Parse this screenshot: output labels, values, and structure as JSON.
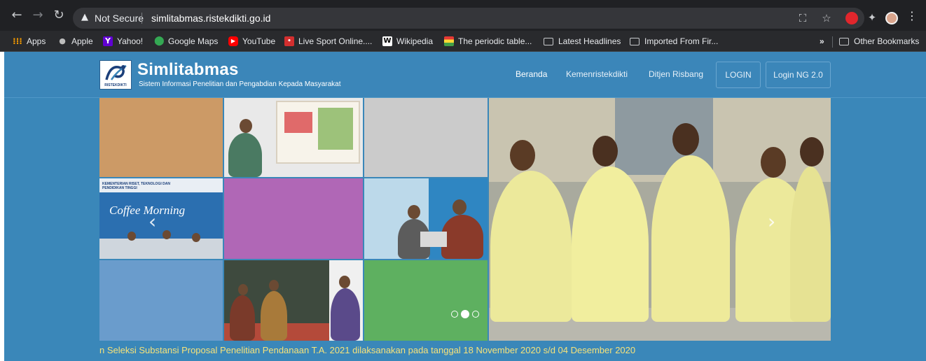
{
  "browser": {
    "security_label": "Not Secure",
    "url": "simlitabmas.ristekdikti.go.id",
    "bookmarks": [
      {
        "label": "Apps",
        "icon": "apps-grid-icon"
      },
      {
        "label": "Apple",
        "icon": "apple-icon"
      },
      {
        "label": "Yahoo!",
        "icon": "yahoo-icon"
      },
      {
        "label": "Google Maps",
        "icon": "maps-pin-icon"
      },
      {
        "label": "YouTube",
        "icon": "youtube-icon"
      },
      {
        "label": "Live Sport Online....",
        "icon": "sport-icon"
      },
      {
        "label": "Wikipedia",
        "icon": "wikipedia-icon"
      },
      {
        "label": "The periodic table...",
        "icon": "periodic-icon"
      },
      {
        "label": "Latest Headlines",
        "icon": "folder-icon"
      },
      {
        "label": "Imported From Fir...",
        "icon": "folder-icon"
      }
    ],
    "overflow_label": "»",
    "other_bookmarks": "Other Bookmarks"
  },
  "site": {
    "title": "Simlitabmas",
    "subtitle": "Sistem Informasi Penelitian dan Pengabdian Kepada Masyarakat",
    "logo_caption": "RISTEKDIKTI",
    "nav": {
      "home": "Beranda",
      "ministry": "Kemenristekdikti",
      "directorate": "Ditjen Risbang",
      "login": "LOGIN",
      "login_ng": "Login NG 2.0"
    },
    "banner_text": "KEMENTERIAN RISET, TEKNOLOGI DAN PENDIDIKAN TINGGI",
    "coffee_text": "Coffee Morning",
    "slider_pages": 3,
    "slider_active": 2,
    "ticker": "n Seleksi Substansi Proposal Penelitian Pendanaan T.A. 2021 dilaksanakan pada tanggal 18 November 2020 s/d 04 Desember 2020"
  },
  "colors": {
    "page_bg": "#3a87b9",
    "tile_tan": "#cc9a66",
    "tile_purple": "#b067b6",
    "tile_blue": "#6a9ccc",
    "tile_green": "#5eb060",
    "tile_gray": "#cbcbcb",
    "ticker": "#f6e27a"
  }
}
